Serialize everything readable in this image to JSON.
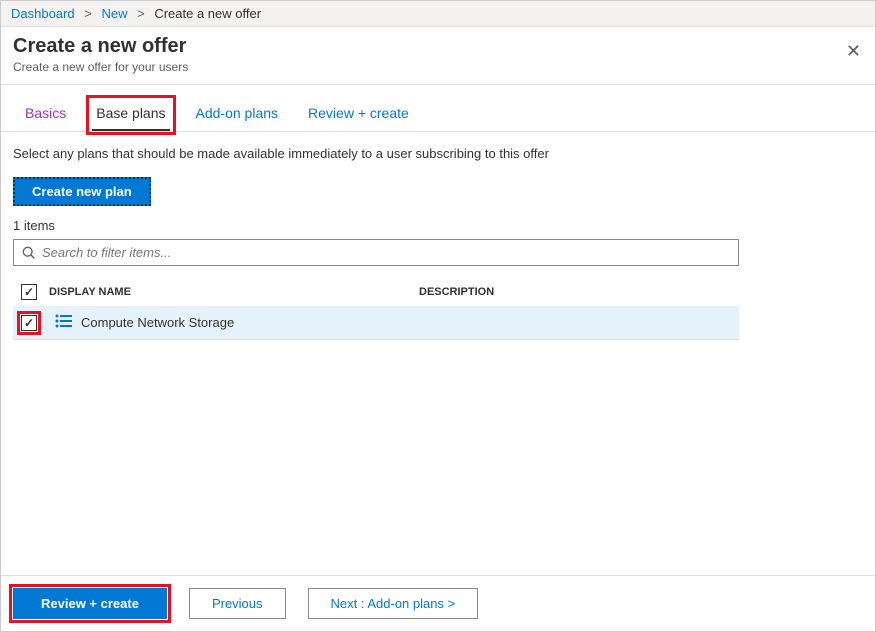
{
  "breadcrumb": {
    "items": [
      {
        "label": "Dashboard",
        "link": true
      },
      {
        "label": "New",
        "link": true
      },
      {
        "label": "Create a new offer",
        "link": false
      }
    ],
    "separator": ">"
  },
  "header": {
    "title": "Create a new offer",
    "subtitle": "Create a new offer for your users"
  },
  "tabs": [
    {
      "label": "Basics",
      "state": "visited"
    },
    {
      "label": "Base plans",
      "state": "active",
      "highlight": true
    },
    {
      "label": "Add-on plans",
      "state": "default"
    },
    {
      "label": "Review + create",
      "state": "default"
    }
  ],
  "content": {
    "description": "Select any plans that should be made available immediately to a user subscribing to this offer",
    "create_plan_label": "Create new plan",
    "items_count": "1 items",
    "search_placeholder": "Search to filter items..."
  },
  "table": {
    "columns": {
      "name": "DISPLAY NAME",
      "description": "DESCRIPTION"
    },
    "rows": [
      {
        "name": "Compute Network Storage",
        "description": "",
        "checked": true,
        "highlight": true
      }
    ]
  },
  "footer": {
    "review_label": "Review + create",
    "previous_label": "Previous",
    "next_label": "Next : Add-on plans >"
  }
}
